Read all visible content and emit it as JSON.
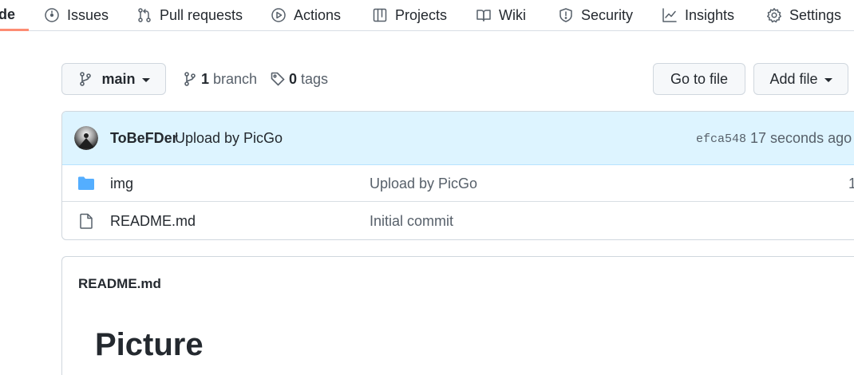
{
  "nav": {
    "tabs": [
      {
        "label": "de",
        "icon": "code-icon"
      },
      {
        "label": "Issues",
        "icon": "issue-icon"
      },
      {
        "label": "Pull requests",
        "icon": "pull-request-icon"
      },
      {
        "label": "Actions",
        "icon": "play-icon"
      },
      {
        "label": "Projects",
        "icon": "table-icon"
      },
      {
        "label": "Wiki",
        "icon": "book-icon"
      },
      {
        "label": "Security",
        "icon": "shield-icon"
      },
      {
        "label": "Insights",
        "icon": "graph-icon"
      },
      {
        "label": "Settings",
        "icon": "gear-icon"
      }
    ],
    "active_color": "#fd8c73"
  },
  "branch_bar": {
    "branch_name": "main",
    "branch_count": "1",
    "branch_label": "branch",
    "tag_count": "0",
    "tag_label": "tags",
    "go_to_file": "Go to file",
    "add_file": "Add file"
  },
  "latest_commit": {
    "author": "ToBeFDer",
    "message": "Upload by PicGo",
    "sha": "efca548",
    "time": "17 seconds ago",
    "background": "#ddf4ff"
  },
  "files": [
    {
      "name": "img",
      "type": "folder",
      "commit_message": "Upload by PicGo",
      "age": "1"
    },
    {
      "name": "README.md",
      "type": "file",
      "commit_message": "Initial commit",
      "age": ""
    }
  ],
  "readme": {
    "filename": "README.md",
    "heading": "Picture"
  }
}
